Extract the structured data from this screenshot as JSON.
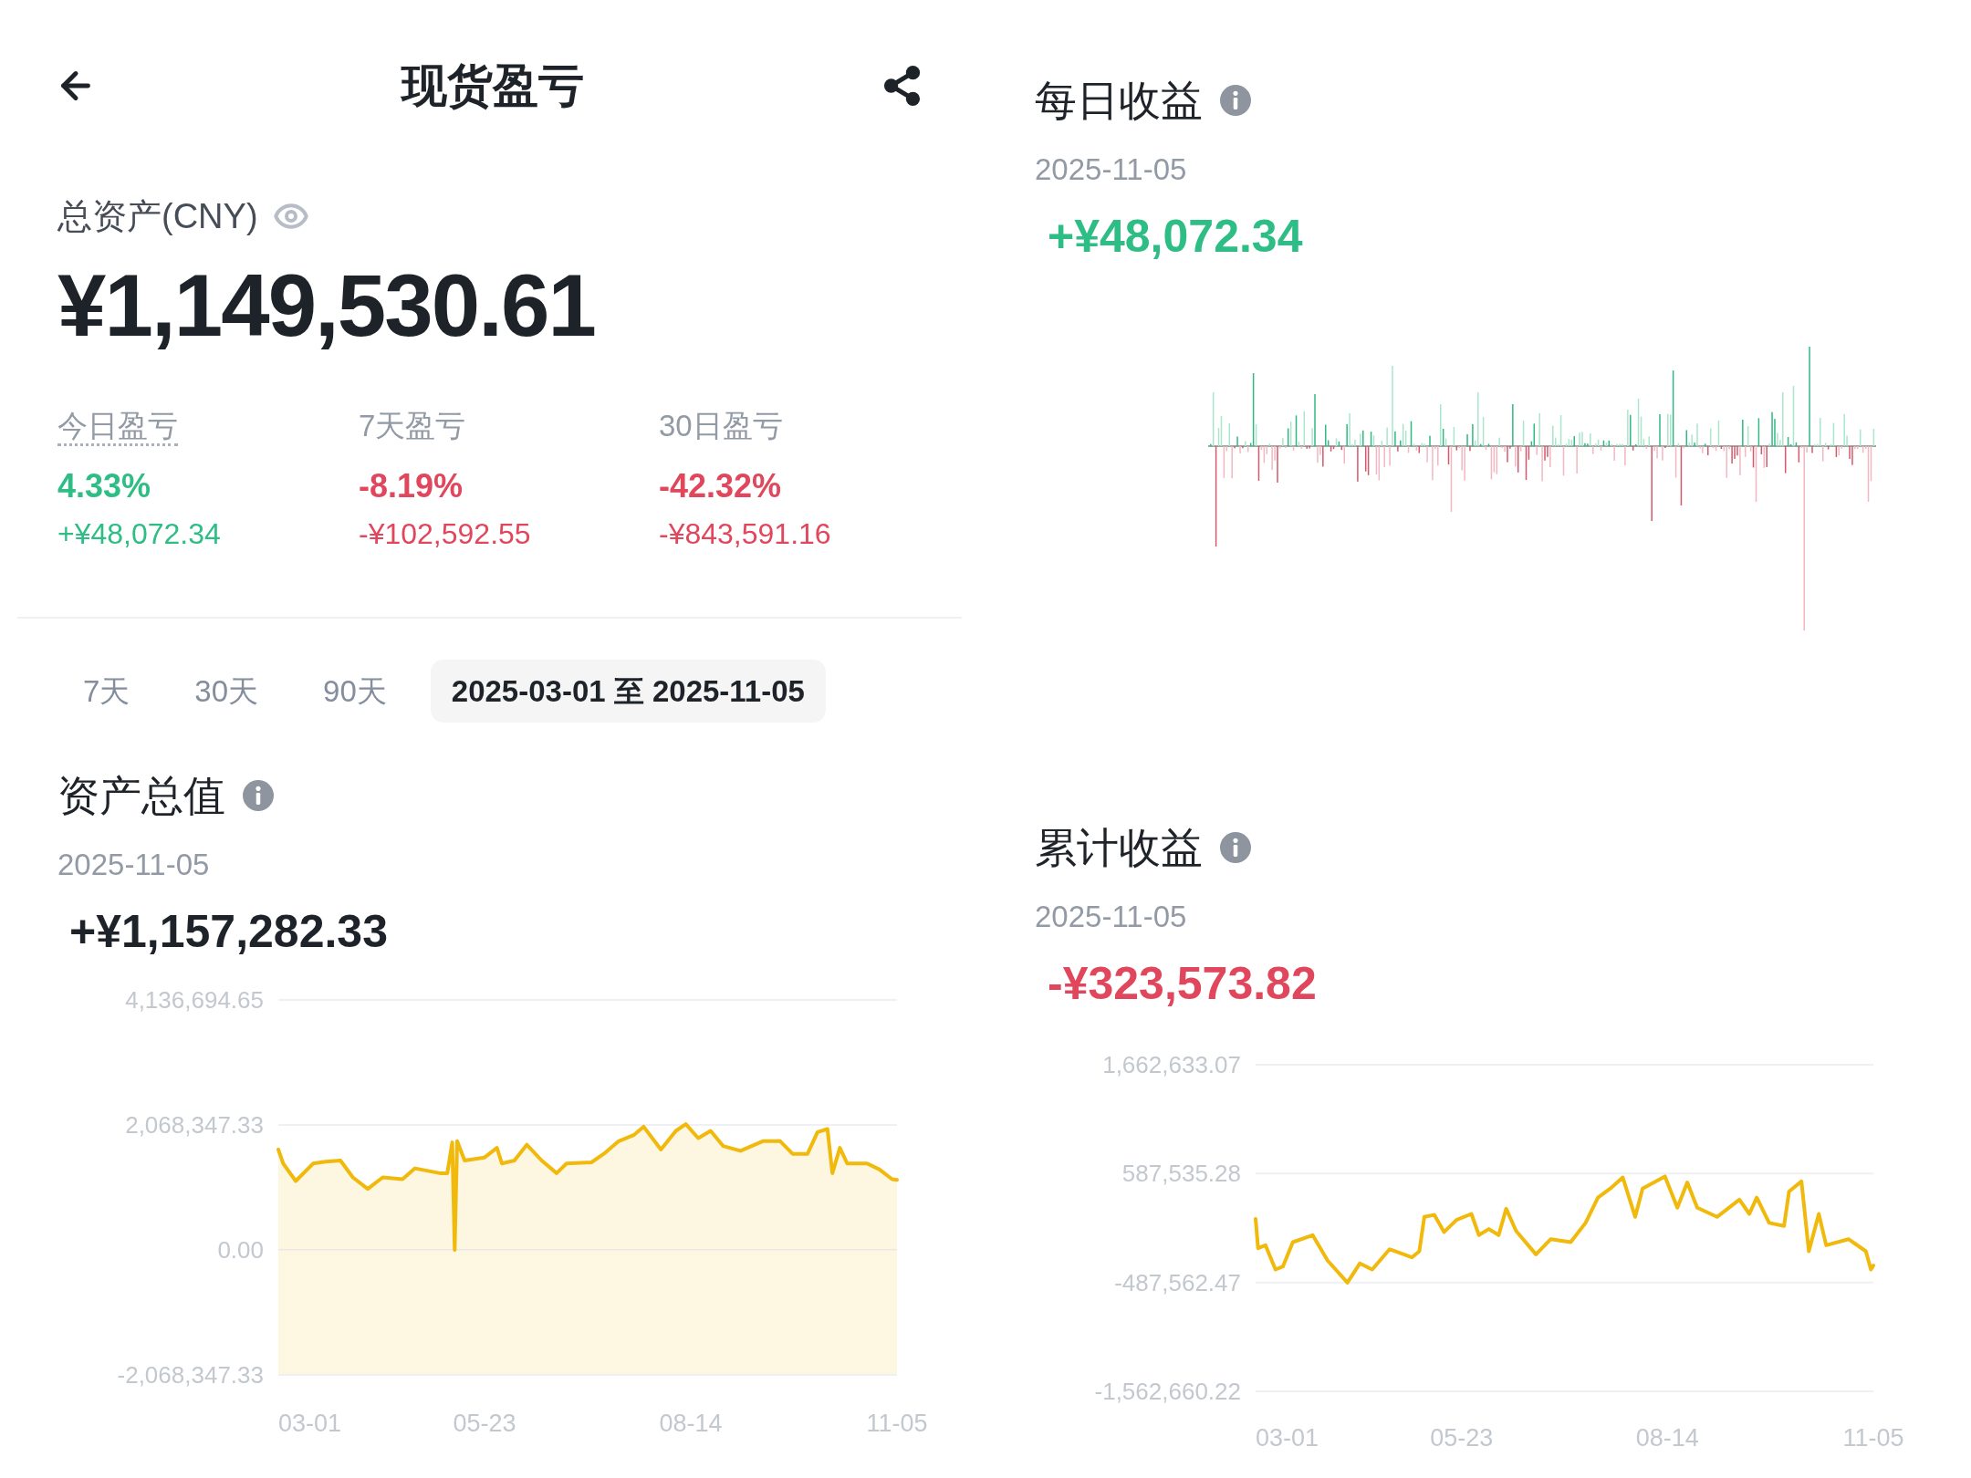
{
  "header": {
    "title": "现货盈亏"
  },
  "total_assets": {
    "label": "总资产(CNY)",
    "value": "¥1,149,530.61"
  },
  "pnl_stats": [
    {
      "label": "今日盈亏",
      "underlined": true,
      "percent": "4.33%",
      "amount": "+¥48,072.34",
      "color": "#2ebd85"
    },
    {
      "label": "7天盈亏",
      "underlined": false,
      "percent": "-8.19%",
      "amount": "-¥102,592.55",
      "color": "#e0475d"
    },
    {
      "label": "30日盈亏",
      "underlined": false,
      "percent": "-42.32%",
      "amount": "-¥843,591.16",
      "color": "#e0475d"
    }
  ],
  "range_tabs": [
    {
      "label": "7天",
      "selected": false
    },
    {
      "label": "30天",
      "selected": false
    },
    {
      "label": "90天",
      "selected": false
    },
    {
      "label": "2025-03-01 至 2025-11-05",
      "selected": true
    }
  ],
  "asset_value": {
    "title": "资产总值",
    "date": "2025-11-05",
    "value": "+¥1,157,282.33",
    "color": "#1e2329",
    "chart_data": [
      {
        "type": "area",
        "color": "#f0b90b",
        "grid": true,
        "xlim": [
          "2025-03-01",
          "2025-11-05"
        ],
        "ylim": [
          -2068347.33,
          4136694.65
        ],
        "yticks": [
          {
            "value": 4136694.65,
            "label": "4,136,694.65"
          },
          {
            "value": 2068347.33,
            "label": "2,068,347.33"
          },
          {
            "value": 0,
            "label": "0.00"
          },
          {
            "value": -2068347.33,
            "label": "-2,068,347.33"
          }
        ],
        "xticks": [
          {
            "value": "2025-03-01",
            "label": "03-01"
          },
          {
            "value": "2025-05-23",
            "label": "05-23"
          },
          {
            "value": "2025-08-14",
            "label": "08-14"
          },
          {
            "value": "2025-11-05",
            "label": "11-05"
          }
        ],
        "x": [
          "2025-03-01",
          "2025-03-03",
          "2025-03-08",
          "2025-03-15",
          "2025-03-20",
          "2025-03-26",
          "2025-03-31",
          "2025-04-06",
          "2025-04-12",
          "2025-04-20",
          "2025-04-25",
          "2025-05-05",
          "2025-05-08",
          "2025-05-10",
          "2025-05-11",
          "2025-05-12",
          "2025-05-15",
          "2025-05-23",
          "2025-05-28",
          "2025-05-30",
          "2025-06-04",
          "2025-06-09",
          "2025-06-15",
          "2025-06-21",
          "2025-06-25",
          "2025-07-05",
          "2025-07-10",
          "2025-07-16",
          "2025-07-22",
          "2025-07-26",
          "2025-08-02",
          "2025-08-08",
          "2025-08-12",
          "2025-08-17",
          "2025-08-22",
          "2025-08-27",
          "2025-09-03",
          "2025-09-12",
          "2025-09-19",
          "2025-09-24",
          "2025-09-30",
          "2025-10-04",
          "2025-10-08",
          "2025-10-10",
          "2025-10-13",
          "2025-10-16",
          "2025-10-24",
          "2025-10-29",
          "2025-11-03",
          "2025-11-05"
        ],
        "values": [
          1660000,
          1430000,
          1140000,
          1430000,
          1460000,
          1480000,
          1200000,
          1010000,
          1200000,
          1170000,
          1350000,
          1270000,
          1270000,
          1780000,
          0,
          1800000,
          1480000,
          1530000,
          1690000,
          1430000,
          1480000,
          1740000,
          1480000,
          1270000,
          1430000,
          1450000,
          1590000,
          1800000,
          1900000,
          2040000,
          1660000,
          1970000,
          2080000,
          1850000,
          1970000,
          1720000,
          1640000,
          1800000,
          1800000,
          1590000,
          1590000,
          1950000,
          2000000,
          1270000,
          1690000,
          1430000,
          1430000,
          1330000,
          1170000,
          1160000
        ]
      }
    ]
  },
  "daily_profit": {
    "title": "每日收益",
    "date": "2025-11-05",
    "value": "+¥48,072.34",
    "color": "#2ebd85"
  },
  "cumulative_profit": {
    "title": "累计收益",
    "date": "2025-11-05",
    "value": "-¥323,573.82",
    "color": "#e0475d",
    "chart_data": [
      {
        "type": "line",
        "color": "#f0b90b",
        "grid": true,
        "xlim": [
          "2025-03-01",
          "2025-11-05"
        ],
        "ylim": [
          -1562660.22,
          1662633.07
        ],
        "yticks": [
          {
            "value": 1662633.07,
            "label": "1,662,633.07"
          },
          {
            "value": 587535.28,
            "label": "587,535.28"
          },
          {
            "value": -487562.47,
            "label": "-487,562.47"
          },
          {
            "value": -1562660.22,
            "label": "-1,562,660.22"
          }
        ],
        "xticks": [
          {
            "value": "2025-03-01",
            "label": "03-01"
          },
          {
            "value": "2025-05-23",
            "label": "05-23"
          },
          {
            "value": "2025-08-14",
            "label": "08-14"
          },
          {
            "value": "2025-11-05",
            "label": "11-05"
          }
        ],
        "x": [
          "2025-03-01",
          "2025-03-02",
          "2025-03-05",
          "2025-03-09",
          "2025-03-12",
          "2025-03-16",
          "2025-03-24",
          "2025-03-30",
          "2025-04-07",
          "2025-04-12",
          "2025-04-17",
          "2025-04-24",
          "2025-05-03",
          "2025-05-06",
          "2025-05-08",
          "2025-05-12",
          "2025-05-16",
          "2025-05-21",
          "2025-05-27",
          "2025-05-30",
          "2025-06-03",
          "2025-06-07",
          "2025-06-10",
          "2025-06-14",
          "2025-06-22",
          "2025-06-28",
          "2025-07-06",
          "2025-07-12",
          "2025-07-17",
          "2025-07-22",
          "2025-07-27",
          "2025-08-01",
          "2025-08-04",
          "2025-08-13",
          "2025-08-18",
          "2025-08-22",
          "2025-08-26",
          "2025-09-03",
          "2025-09-12",
          "2025-09-16",
          "2025-09-19",
          "2025-09-24",
          "2025-09-30",
          "2025-10-02",
          "2025-10-07",
          "2025-10-10",
          "2025-10-14",
          "2025-10-17",
          "2025-10-26",
          "2025-11-02",
          "2025-11-04",
          "2025-11-05"
        ],
        "values": [
          140000,
          -150000,
          -120000,
          -360000,
          -330000,
          -90000,
          -20000,
          -270000,
          -490000,
          -300000,
          -360000,
          -160000,
          -240000,
          -180000,
          160000,
          180000,
          10000,
          130000,
          190000,
          -20000,
          40000,
          -20000,
          240000,
          20000,
          -210000,
          -60000,
          -90000,
          100000,
          350000,
          440000,
          550000,
          160000,
          440000,
          560000,
          250000,
          500000,
          250000,
          160000,
          330000,
          190000,
          350000,
          100000,
          70000,
          410000,
          510000,
          -180000,
          190000,
          -120000,
          -60000,
          -180000,
          -360000,
          -320000
        ]
      }
    ]
  }
}
